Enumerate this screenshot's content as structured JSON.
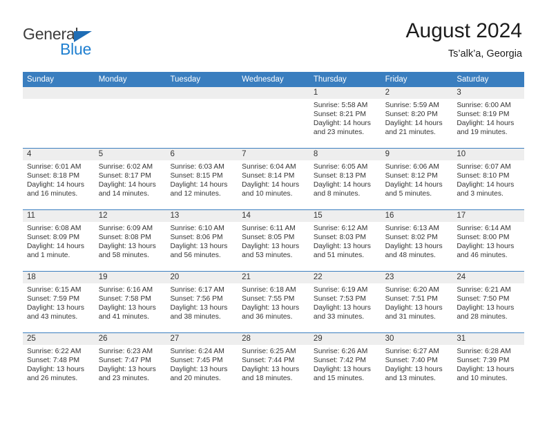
{
  "brand": {
    "name_part1": "General",
    "name_part2": "Blue",
    "triangle_icon": "triangle-icon",
    "colors": {
      "dark": "#3c3c3c",
      "blue": "#1f7fd0",
      "triangle": "#1f6db5"
    }
  },
  "header": {
    "title": "August 2024",
    "subtitle": "Ts’alk’a, Georgia"
  },
  "theme": {
    "header_blue": "#3a7ebf",
    "daynum_band": "#eeeeee",
    "text": "#333333"
  },
  "weekdays": [
    "Sunday",
    "Monday",
    "Tuesday",
    "Wednesday",
    "Thursday",
    "Friday",
    "Saturday"
  ],
  "weeks": [
    [
      {
        "day": "",
        "sunrise": "",
        "sunset": "",
        "daylight_line1": "",
        "daylight_line2": ""
      },
      {
        "day": "",
        "sunrise": "",
        "sunset": "",
        "daylight_line1": "",
        "daylight_line2": ""
      },
      {
        "day": "",
        "sunrise": "",
        "sunset": "",
        "daylight_line1": "",
        "daylight_line2": ""
      },
      {
        "day": "",
        "sunrise": "",
        "sunset": "",
        "daylight_line1": "",
        "daylight_line2": ""
      },
      {
        "day": "1",
        "sunrise": "Sunrise: 5:58 AM",
        "sunset": "Sunset: 8:21 PM",
        "daylight_line1": "Daylight: 14 hours",
        "daylight_line2": "and 23 minutes."
      },
      {
        "day": "2",
        "sunrise": "Sunrise: 5:59 AM",
        "sunset": "Sunset: 8:20 PM",
        "daylight_line1": "Daylight: 14 hours",
        "daylight_line2": "and 21 minutes."
      },
      {
        "day": "3",
        "sunrise": "Sunrise: 6:00 AM",
        "sunset": "Sunset: 8:19 PM",
        "daylight_line1": "Daylight: 14 hours",
        "daylight_line2": "and 19 minutes."
      }
    ],
    [
      {
        "day": "4",
        "sunrise": "Sunrise: 6:01 AM",
        "sunset": "Sunset: 8:18 PM",
        "daylight_line1": "Daylight: 14 hours",
        "daylight_line2": "and 16 minutes."
      },
      {
        "day": "5",
        "sunrise": "Sunrise: 6:02 AM",
        "sunset": "Sunset: 8:17 PM",
        "daylight_line1": "Daylight: 14 hours",
        "daylight_line2": "and 14 minutes."
      },
      {
        "day": "6",
        "sunrise": "Sunrise: 6:03 AM",
        "sunset": "Sunset: 8:15 PM",
        "daylight_line1": "Daylight: 14 hours",
        "daylight_line2": "and 12 minutes."
      },
      {
        "day": "7",
        "sunrise": "Sunrise: 6:04 AM",
        "sunset": "Sunset: 8:14 PM",
        "daylight_line1": "Daylight: 14 hours",
        "daylight_line2": "and 10 minutes."
      },
      {
        "day": "8",
        "sunrise": "Sunrise: 6:05 AM",
        "sunset": "Sunset: 8:13 PM",
        "daylight_line1": "Daylight: 14 hours",
        "daylight_line2": "and 8 minutes."
      },
      {
        "day": "9",
        "sunrise": "Sunrise: 6:06 AM",
        "sunset": "Sunset: 8:12 PM",
        "daylight_line1": "Daylight: 14 hours",
        "daylight_line2": "and 5 minutes."
      },
      {
        "day": "10",
        "sunrise": "Sunrise: 6:07 AM",
        "sunset": "Sunset: 8:10 PM",
        "daylight_line1": "Daylight: 14 hours",
        "daylight_line2": "and 3 minutes."
      }
    ],
    [
      {
        "day": "11",
        "sunrise": "Sunrise: 6:08 AM",
        "sunset": "Sunset: 8:09 PM",
        "daylight_line1": "Daylight: 14 hours",
        "daylight_line2": "and 1 minute."
      },
      {
        "day": "12",
        "sunrise": "Sunrise: 6:09 AM",
        "sunset": "Sunset: 8:08 PM",
        "daylight_line1": "Daylight: 13 hours",
        "daylight_line2": "and 58 minutes."
      },
      {
        "day": "13",
        "sunrise": "Sunrise: 6:10 AM",
        "sunset": "Sunset: 8:06 PM",
        "daylight_line1": "Daylight: 13 hours",
        "daylight_line2": "and 56 minutes."
      },
      {
        "day": "14",
        "sunrise": "Sunrise: 6:11 AM",
        "sunset": "Sunset: 8:05 PM",
        "daylight_line1": "Daylight: 13 hours",
        "daylight_line2": "and 53 minutes."
      },
      {
        "day": "15",
        "sunrise": "Sunrise: 6:12 AM",
        "sunset": "Sunset: 8:03 PM",
        "daylight_line1": "Daylight: 13 hours",
        "daylight_line2": "and 51 minutes."
      },
      {
        "day": "16",
        "sunrise": "Sunrise: 6:13 AM",
        "sunset": "Sunset: 8:02 PM",
        "daylight_line1": "Daylight: 13 hours",
        "daylight_line2": "and 48 minutes."
      },
      {
        "day": "17",
        "sunrise": "Sunrise: 6:14 AM",
        "sunset": "Sunset: 8:00 PM",
        "daylight_line1": "Daylight: 13 hours",
        "daylight_line2": "and 46 minutes."
      }
    ],
    [
      {
        "day": "18",
        "sunrise": "Sunrise: 6:15 AM",
        "sunset": "Sunset: 7:59 PM",
        "daylight_line1": "Daylight: 13 hours",
        "daylight_line2": "and 43 minutes."
      },
      {
        "day": "19",
        "sunrise": "Sunrise: 6:16 AM",
        "sunset": "Sunset: 7:58 PM",
        "daylight_line1": "Daylight: 13 hours",
        "daylight_line2": "and 41 minutes."
      },
      {
        "day": "20",
        "sunrise": "Sunrise: 6:17 AM",
        "sunset": "Sunset: 7:56 PM",
        "daylight_line1": "Daylight: 13 hours",
        "daylight_line2": "and 38 minutes."
      },
      {
        "day": "21",
        "sunrise": "Sunrise: 6:18 AM",
        "sunset": "Sunset: 7:55 PM",
        "daylight_line1": "Daylight: 13 hours",
        "daylight_line2": "and 36 minutes."
      },
      {
        "day": "22",
        "sunrise": "Sunrise: 6:19 AM",
        "sunset": "Sunset: 7:53 PM",
        "daylight_line1": "Daylight: 13 hours",
        "daylight_line2": "and 33 minutes."
      },
      {
        "day": "23",
        "sunrise": "Sunrise: 6:20 AM",
        "sunset": "Sunset: 7:51 PM",
        "daylight_line1": "Daylight: 13 hours",
        "daylight_line2": "and 31 minutes."
      },
      {
        "day": "24",
        "sunrise": "Sunrise: 6:21 AM",
        "sunset": "Sunset: 7:50 PM",
        "daylight_line1": "Daylight: 13 hours",
        "daylight_line2": "and 28 minutes."
      }
    ],
    [
      {
        "day": "25",
        "sunrise": "Sunrise: 6:22 AM",
        "sunset": "Sunset: 7:48 PM",
        "daylight_line1": "Daylight: 13 hours",
        "daylight_line2": "and 26 minutes."
      },
      {
        "day": "26",
        "sunrise": "Sunrise: 6:23 AM",
        "sunset": "Sunset: 7:47 PM",
        "daylight_line1": "Daylight: 13 hours",
        "daylight_line2": "and 23 minutes."
      },
      {
        "day": "27",
        "sunrise": "Sunrise: 6:24 AM",
        "sunset": "Sunset: 7:45 PM",
        "daylight_line1": "Daylight: 13 hours",
        "daylight_line2": "and 20 minutes."
      },
      {
        "day": "28",
        "sunrise": "Sunrise: 6:25 AM",
        "sunset": "Sunset: 7:44 PM",
        "daylight_line1": "Daylight: 13 hours",
        "daylight_line2": "and 18 minutes."
      },
      {
        "day": "29",
        "sunrise": "Sunrise: 6:26 AM",
        "sunset": "Sunset: 7:42 PM",
        "daylight_line1": "Daylight: 13 hours",
        "daylight_line2": "and 15 minutes."
      },
      {
        "day": "30",
        "sunrise": "Sunrise: 6:27 AM",
        "sunset": "Sunset: 7:40 PM",
        "daylight_line1": "Daylight: 13 hours",
        "daylight_line2": "and 13 minutes."
      },
      {
        "day": "31",
        "sunrise": "Sunrise: 6:28 AM",
        "sunset": "Sunset: 7:39 PM",
        "daylight_line1": "Daylight: 13 hours",
        "daylight_line2": "and 10 minutes."
      }
    ]
  ]
}
